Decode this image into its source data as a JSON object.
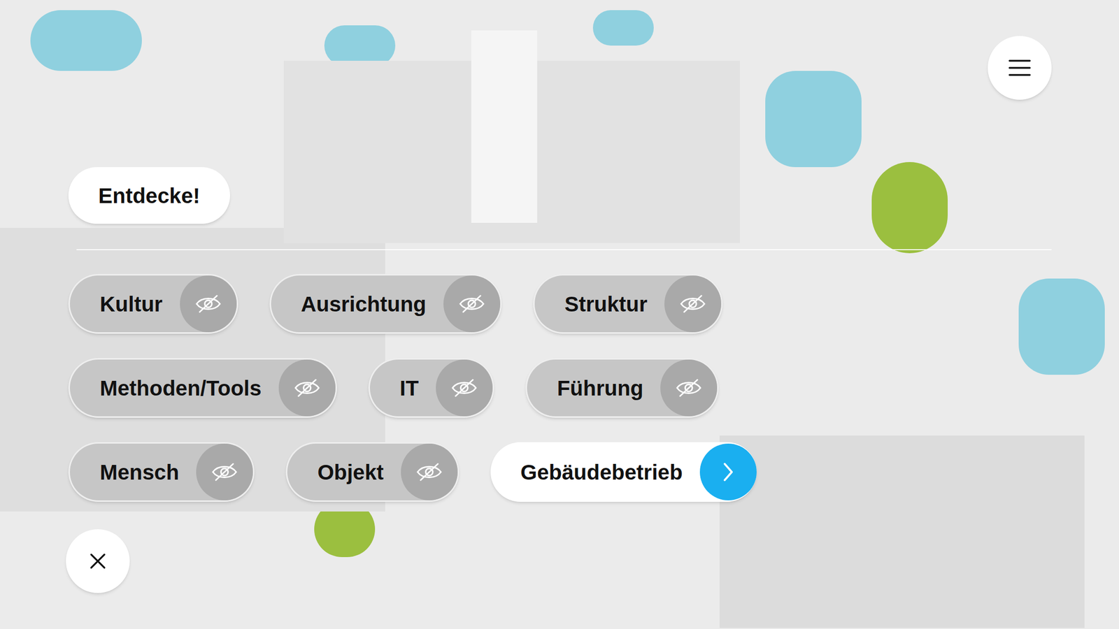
{
  "header": {
    "label": "Entdecke!"
  },
  "categories": [
    {
      "label": "Kultur",
      "kind": "toggle",
      "hidden": true
    },
    {
      "label": "Ausrichtung",
      "kind": "toggle",
      "hidden": true
    },
    {
      "label": "Struktur",
      "kind": "toggle",
      "hidden": true
    },
    {
      "label": "Methoden/Tools",
      "kind": "toggle",
      "hidden": true
    },
    {
      "label": "IT",
      "kind": "toggle",
      "hidden": true
    },
    {
      "label": "Führung",
      "kind": "toggle",
      "hidden": true
    },
    {
      "label": "Mensch",
      "kind": "toggle",
      "hidden": true
    },
    {
      "label": "Objekt",
      "kind": "toggle",
      "hidden": true
    },
    {
      "label": "Gebäudebetrieb",
      "kind": "link",
      "hidden": false
    }
  ]
}
